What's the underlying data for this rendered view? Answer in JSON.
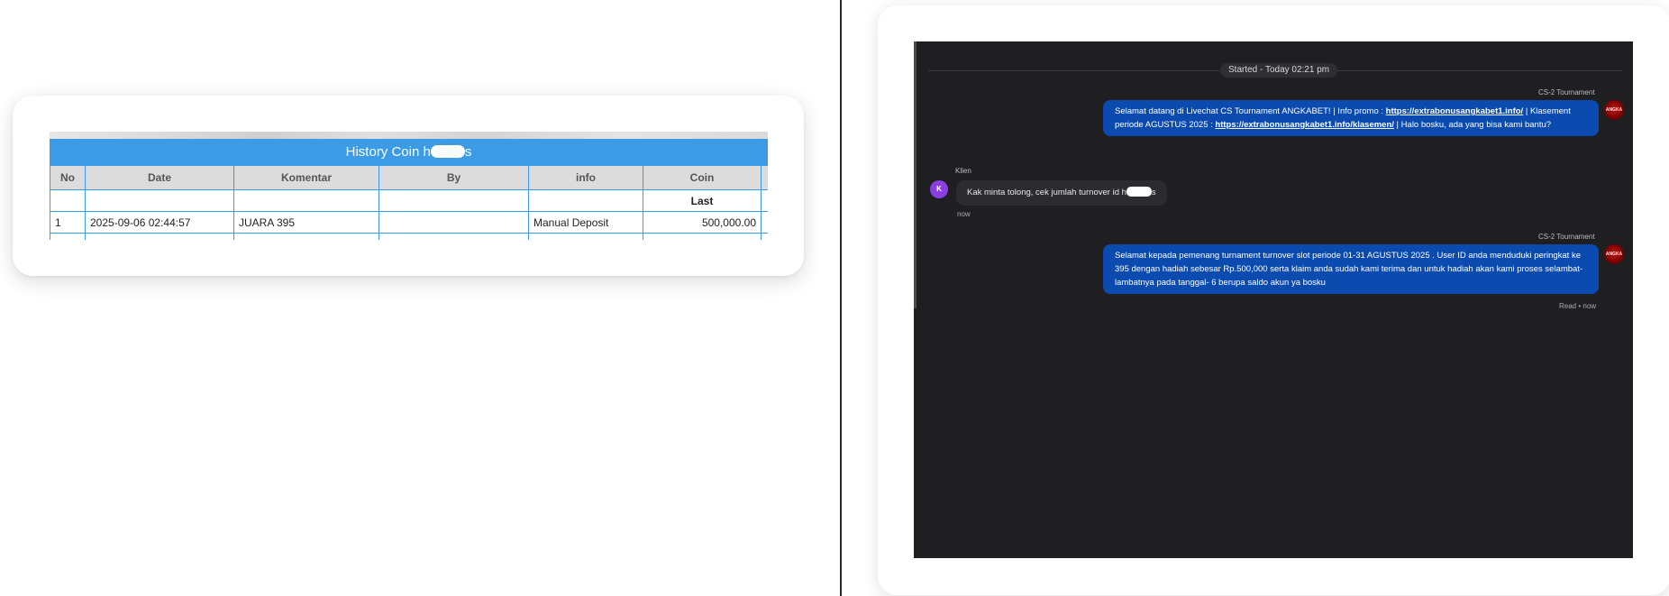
{
  "history": {
    "title_prefix": "History Coin h",
    "title_suffix": "s",
    "columns": [
      "No",
      "Date",
      "Komentar",
      "By",
      "info",
      "Coin"
    ],
    "last_label": "Last",
    "rows": [
      {
        "no": "1",
        "date": "2025-09-06 02:44:57",
        "komentar": "JUARA 395",
        "by": "",
        "info": "Manual Deposit",
        "coin": "500,000.00"
      }
    ],
    "colors": {
      "header_bar": "#3c9be6",
      "coin_positive": "#1b8a1b"
    }
  },
  "chat": {
    "started": "Started - Today 02:21 pm",
    "messages": [
      {
        "sender": "CS-2 Tournament",
        "type": "agent",
        "text_1": "Selamat datang di Livechat CS Tournament ANGKABET! | Info promo : ",
        "link_1": "https://extrabonusangkabet1.info/",
        "text_2": " | Klasement periode AGUSTUS 2025 : ",
        "link_2": "https://extrabonusangkabet1.info/klasemen/",
        "text_3": " | Halo bosku, ada yang bisa kami bantu?"
      },
      {
        "sender": "Klien",
        "type": "client",
        "avatar_letter": "K",
        "text_prefix": "Kak minta tolong, cek jumlah turnover id h",
        "text_suffix": "s",
        "time": "now"
      },
      {
        "sender": "CS-2 Tournament",
        "type": "agent",
        "text": "Selamat kepada pemenang turnament turnover slot periode 01-31 AGUSTUS 2025 . User ID anda menduduki peringkat ke 395 dengan hadiah sebesar Rp.500,000 serta klaim anda sudah kami terima dan untuk hadiah akan kami proses selambat-lambatnya pada tanggal- 6 berupa saldo akun ya bosku",
        "status": "Read • now"
      }
    ],
    "colors": {
      "agent_bubble": "#0b4bb0",
      "background": "#1f1f22",
      "client_avatar": "#8b3fe0"
    },
    "icons": {
      "agent_avatar": "angkabet-logo-icon",
      "client_avatar": "client-avatar-icon"
    }
  }
}
